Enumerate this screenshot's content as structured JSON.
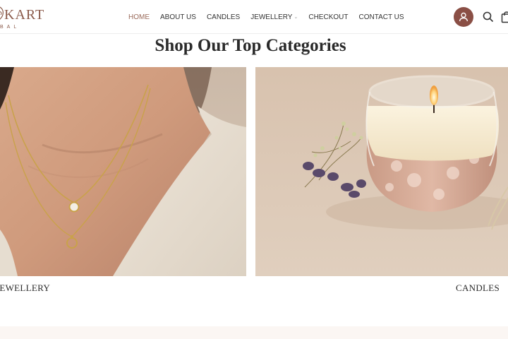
{
  "brand": {
    "name": "KART",
    "tagline": "BAL"
  },
  "nav": {
    "items": [
      {
        "label": "HOME",
        "active": true
      },
      {
        "label": "ABOUT US",
        "active": false
      },
      {
        "label": "CANDLES",
        "active": false
      },
      {
        "label": "JEWELLERY",
        "active": false,
        "has_dropdown": true
      },
      {
        "label": "CHECKOUT",
        "active": false
      },
      {
        "label": "CONTACT US",
        "active": false
      }
    ],
    "dropdown_caret": "⌄"
  },
  "header_icons": [
    "user-avatar-icon",
    "search-icon",
    "cart-icon"
  ],
  "section": {
    "title": "Shop Our Top Categories"
  },
  "categories": [
    {
      "label": "JEWELLERY",
      "image": "gold-necklace-photo"
    },
    {
      "label": "CANDLES",
      "image": "candle-jar-photo"
    }
  ],
  "colors": {
    "accent": "#9a6a5a",
    "avatar_bg": "#8a4f45"
  }
}
